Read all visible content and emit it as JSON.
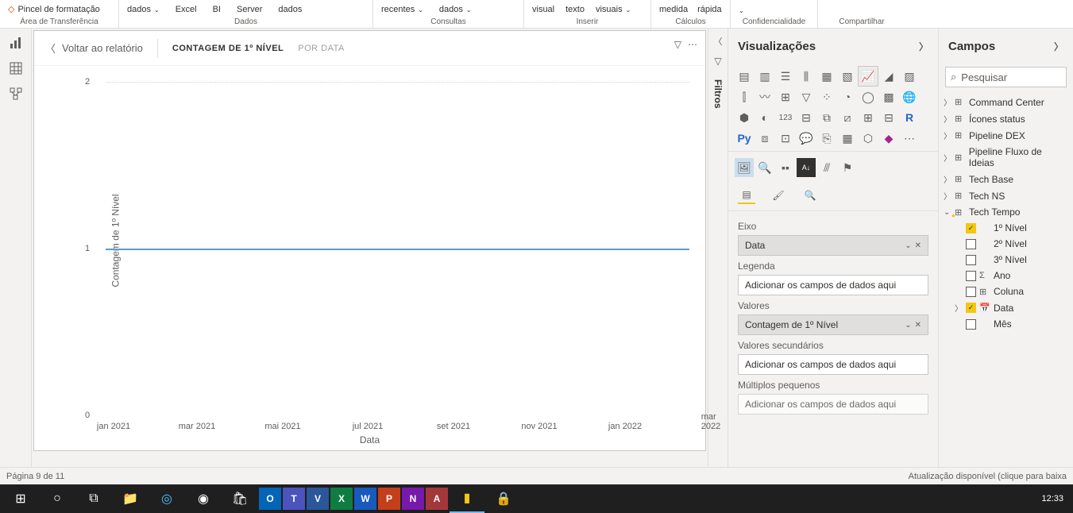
{
  "ribbon": {
    "pincel": "Pincel de formatação",
    "dados": "dados",
    "excel": "Excel",
    "bi": "BI",
    "server": "Server",
    "dados2": "dados",
    "recentes": "recentes",
    "dados3": "dados",
    "visual": "visual",
    "texto": "texto",
    "visuais": "visuais",
    "medida": "medida",
    "rapida": "rápida",
    "groups": {
      "area": "Área de Transferência",
      "dados": "Dados",
      "consultas": "Consultas",
      "inserir": "Inserir",
      "calculos": "Cálculos",
      "conf": "Confidencialidade",
      "comp": "Compartilhar"
    }
  },
  "canvas": {
    "back": "Voltar ao relatório",
    "crumb1": "CONTAGEM DE 1º NÍVEL",
    "crumb2": "POR DATA"
  },
  "filters_label": "Filtros",
  "viz": {
    "title": "Visualizações",
    "axis_label": "Eixo",
    "axis_well": "Data",
    "legend_label": "Legenda",
    "legend_well": "Adicionar os campos de dados aqui",
    "values_label": "Valores",
    "values_well": "Contagem de 1º Nível",
    "sec_label": "Valores secundários",
    "sec_well": "Adicionar os campos de dados aqui",
    "mult_label": "Múltiplos pequenos",
    "mult_well": "Adicionar os campos de dados aqui"
  },
  "fields": {
    "title": "Campos",
    "search": "Pesquisar",
    "tables": {
      "cc": "Command Center",
      "icones": "Ícones status",
      "pdex": "Pipeline DEX",
      "pflux": "Pipeline Fluxo de Ideias",
      "tbase": "Tech Base",
      "tns": "Tech NS",
      "ttempo": "Tech Tempo"
    },
    "cols": {
      "n1": "1º Nível",
      "n2": "2º Nível",
      "n3": "3º Nível",
      "ano": "Ano",
      "coluna": "Coluna",
      "data": "Data",
      "mes": "Mês"
    }
  },
  "statusbar": {
    "page": "Página 9 de 11",
    "update": "Atualização disponível (clique para baixa"
  },
  "clock": "12:33",
  "chart_data": {
    "type": "line",
    "title": "",
    "xlabel": "Data",
    "ylabel": "Contagem de 1º Nível",
    "ylim": [
      0,
      2
    ],
    "yticks": [
      0,
      1,
      2
    ],
    "x": [
      "jan 2021",
      "mar 2021",
      "mai 2021",
      "jul 2021",
      "set 2021",
      "nov 2021",
      "jan 2022",
      "mar 2022"
    ],
    "series": [
      {
        "name": "Contagem de 1º Nível",
        "values": [
          1,
          1,
          1,
          1,
          1,
          1,
          1,
          1
        ]
      }
    ]
  }
}
